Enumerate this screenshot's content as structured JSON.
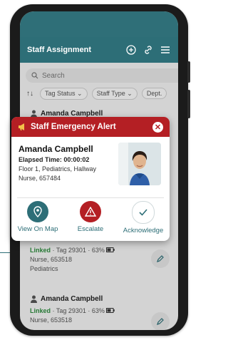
{
  "header": {
    "title": "Staff Assignment"
  },
  "search": {
    "placeholder": "Search"
  },
  "filters": {
    "sort_label": "↑↓",
    "tag_status": "Tag Status",
    "staff_type": "Staff Type",
    "dept": "Dept."
  },
  "list": [
    {
      "name": "Amanda Campbell",
      "linked": "Linked",
      "tag": "Tag 29301 · 63%",
      "role": "Nurse, 653518",
      "dept": "Pediatrics"
    },
    {
      "name": "Amanda Campbell",
      "linked": "Linked",
      "tag": "Tag 29301 · 63%",
      "role": "Nurse, 653518"
    }
  ],
  "alert": {
    "title": "Staff Emergency Alert",
    "name": "Amanda Campbell",
    "elapsed": "Elapsed Time: 00:00:02",
    "location": "Floor 1, Pediatrics, Hallway",
    "role": "Nurse, 657484",
    "actions": [
      {
        "label": "View On Map",
        "icon": "map-pin-icon",
        "color": "#2d6e77"
      },
      {
        "label": "Escalate",
        "icon": "warning-icon",
        "color": "#b41f24"
      },
      {
        "label": "Acknowledge",
        "icon": "check-icon",
        "color": "#ffffff"
      }
    ]
  },
  "colors": {
    "brand": "#2d6e77",
    "alert": "#b41f24",
    "linked": "#2e8b3e"
  }
}
